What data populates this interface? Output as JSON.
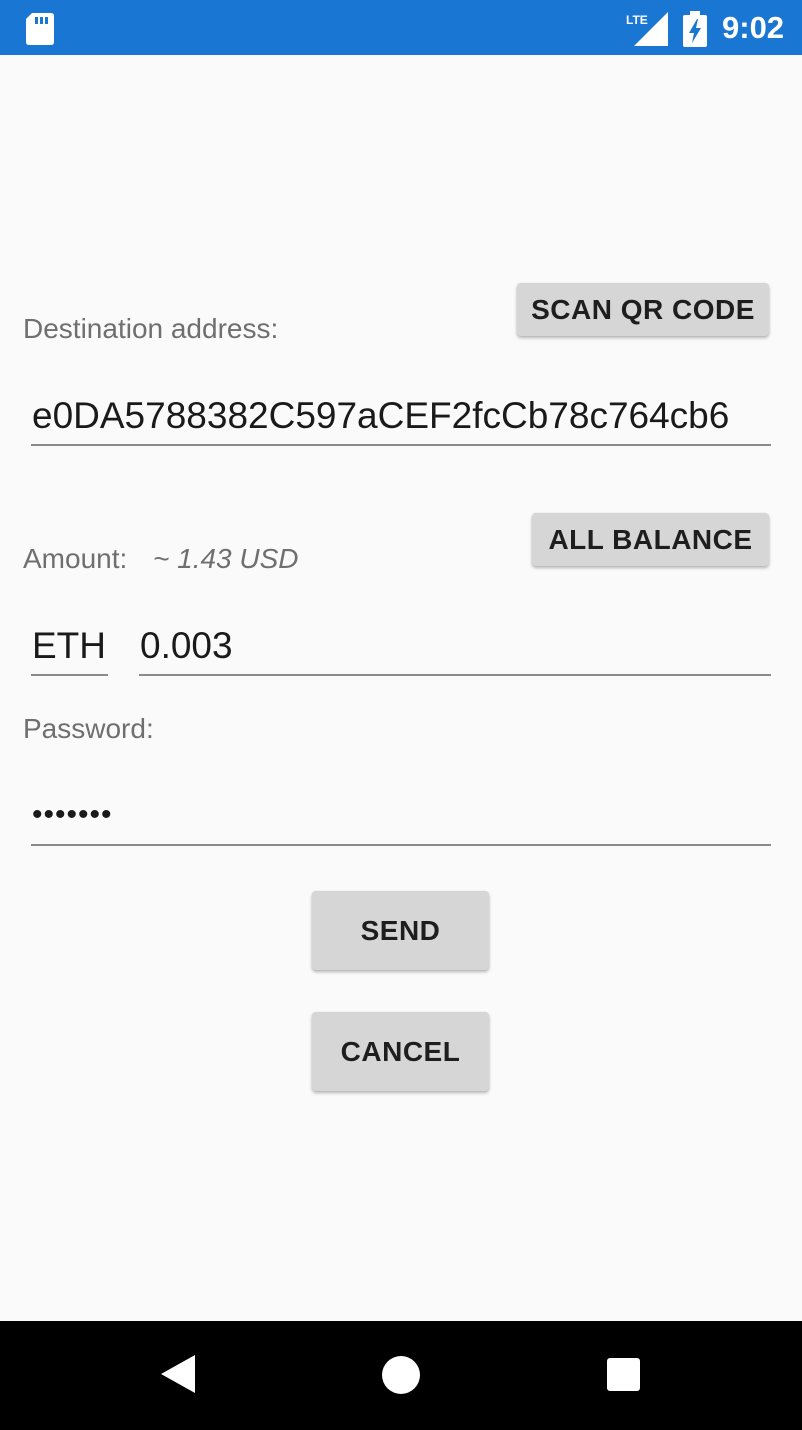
{
  "status_bar": {
    "time": "9:02",
    "network": "LTE",
    "bg_color": "#1976d2",
    "icons": [
      "sd-card-icon",
      "lte-signal-icon",
      "battery-charging-icon"
    ]
  },
  "form": {
    "destination": {
      "label": "Destination address:",
      "scan_button": "SCAN QR CODE",
      "value": "e0DA5788382C597aCEF2fcCb78c764cb6"
    },
    "amount": {
      "label": "Amount:",
      "usd_estimate": "~ 1.43 USD",
      "all_balance_button": "ALL BALANCE",
      "currency": "ETH",
      "value": "0.003"
    },
    "password": {
      "label": "Password:",
      "value": "•••••••"
    },
    "send_button": "SEND",
    "cancel_button": "CANCEL"
  },
  "nav_bar": {
    "icons": [
      "back-icon",
      "home-icon",
      "recents-icon"
    ]
  }
}
